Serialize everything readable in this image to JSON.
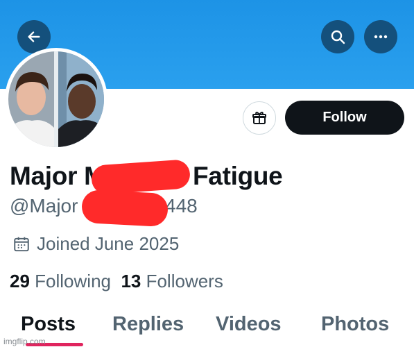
{
  "header": {
    "back_icon": "arrow-left-icon",
    "search_icon": "search-icon",
    "more_icon": "more-horizontal-icon",
    "banner_color": "#1d93e6"
  },
  "profile": {
    "name_part1": "Major M",
    "name_part2": "Fatigue",
    "handle_part1": "@Major",
    "handle_part2": "448",
    "joined": "Joined June 2025",
    "following_count": "29",
    "following_label": "Following",
    "followers_count": "13",
    "followers_label": "Followers"
  },
  "actions": {
    "gift_icon": "gift-icon",
    "follow_label": "Follow"
  },
  "tabs": [
    {
      "label": "Posts",
      "active": true
    },
    {
      "label": "Replies",
      "active": false
    },
    {
      "label": "Videos",
      "active": false
    },
    {
      "label": "Photos",
      "active": false
    }
  ],
  "accent_color": "#e0245e",
  "watermark": "imgflip.com"
}
